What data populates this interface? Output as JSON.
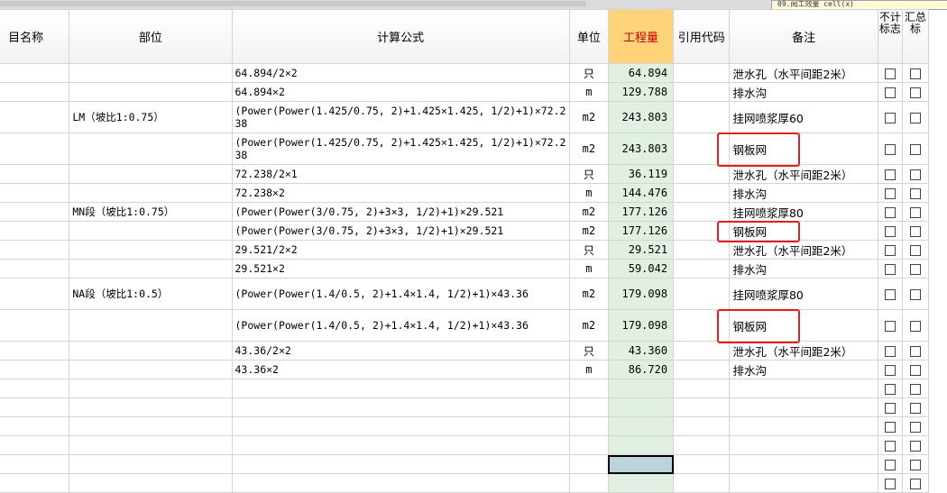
{
  "top": {
    "cell_label": "09.阅工效量 cell(x)"
  },
  "headers": {
    "name": "目名称",
    "part": "部位",
    "formula": "计算公式",
    "unit": "单位",
    "quantity": "工程量",
    "ref": "引用代码",
    "remark": "备注",
    "noncount": "不计标志",
    "summary": "汇总标"
  },
  "rows": [
    {
      "part": "",
      "formula": "64.894/2×2",
      "unit": "只",
      "qty": "64.894",
      "remark": "泄水孔（水平间距2米）"
    },
    {
      "part": "",
      "formula": "64.894×2",
      "unit": "m",
      "qty": "129.788",
      "remark": "排水沟"
    },
    {
      "part": "LM（坡比1:0.75）",
      "formula": "(Power(Power(1.425/0.75, 2)+1.425×1.425, 1/2)+1)×72.238",
      "unit": "m2",
      "qty": "243.803",
      "remark": "挂网喷浆厚60"
    },
    {
      "part": "",
      "formula": "(Power(Power(1.425/0.75, 2)+1.425×1.425, 1/2)+1)×72.238",
      "unit": "m2",
      "qty": "243.803",
      "remark": "钢板网"
    },
    {
      "part": "",
      "formula": "72.238/2×1",
      "unit": "只",
      "qty": "36.119",
      "remark": "泄水孔（水平间距2米）"
    },
    {
      "part": "",
      "formula": "72.238×2",
      "unit": "m",
      "qty": "144.476",
      "remark": "排水沟"
    },
    {
      "part": "MN段（坡比1:0.75）",
      "formula": "(Power(Power(3/0.75, 2)+3×3, 1/2)+1)×29.521",
      "unit": "m2",
      "qty": "177.126",
      "remark": "挂网喷浆厚80"
    },
    {
      "part": "",
      "formula": "(Power(Power(3/0.75, 2)+3×3, 1/2)+1)×29.521",
      "unit": "m2",
      "qty": "177.126",
      "remark": "钢板网"
    },
    {
      "part": "",
      "formula": "29.521/2×2",
      "unit": "只",
      "qty": "29.521",
      "remark": "泄水孔（水平间距2米）"
    },
    {
      "part": "",
      "formula": "29.521×2",
      "unit": "m",
      "qty": "59.042",
      "remark": "排水沟"
    },
    {
      "part": "NA段（坡比1:0.5）",
      "formula": "(Power(Power(1.4/0.5, 2)+1.4×1.4, 1/2)+1)×43.36",
      "unit": "m2",
      "qty": "179.098",
      "remark": "挂网喷浆厚80"
    },
    {
      "part": "",
      "formula": "(Power(Power(1.4/0.5, 2)+1.4×1.4, 1/2)+1)×43.36",
      "unit": "m2",
      "qty": "179.098",
      "remark": "钢板网"
    },
    {
      "part": "",
      "formula": "43.36/2×2",
      "unit": "只",
      "qty": "43.360",
      "remark": "泄水孔（水平间距2米）"
    },
    {
      "part": "",
      "formula": "43.36×2",
      "unit": "m",
      "qty": "86.720",
      "remark": "排水沟"
    },
    {
      "part": "",
      "formula": "",
      "unit": "",
      "qty": "",
      "remark": ""
    },
    {
      "part": "",
      "formula": "",
      "unit": "",
      "qty": "",
      "remark": ""
    },
    {
      "part": "",
      "formula": "",
      "unit": "",
      "qty": "",
      "remark": ""
    },
    {
      "part": "",
      "formula": "",
      "unit": "",
      "qty": "",
      "remark": ""
    },
    {
      "part": "",
      "formula": "",
      "unit": "",
      "qty": "",
      "remark": ""
    },
    {
      "part": "",
      "formula": "",
      "unit": "",
      "qty": "",
      "remark": ""
    }
  ],
  "highlight_color": "#e02020",
  "selected_row": 18
}
